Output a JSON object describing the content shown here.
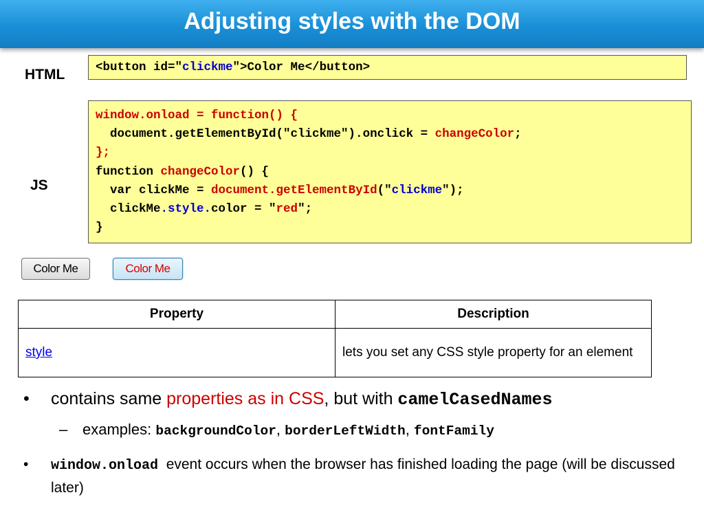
{
  "title": "Adjusting styles with the DOM",
  "labels": {
    "html": "HTML",
    "js": "JS"
  },
  "html_code": {
    "p1": "<button id=\"",
    "p2": "clickme",
    "p3": "\">Color Me</button>"
  },
  "js_code": {
    "l1": "window.onload = function() {",
    "l2a": "  document.getElementById(\"clickme\").onclick = ",
    "l2b": "changeColor",
    "l2c": ";",
    "l3": "};",
    "l4a": "function ",
    "l4b": "changeColor",
    "l4c": "() {",
    "l5a": "  var clickMe = ",
    "l5b": "document.getElementById",
    "l5c": "(\"",
    "l5d": "clickme",
    "l5e": "\");",
    "l6a": "  clickMe",
    "l6b": ".style.",
    "l6c": "color = \"",
    "l6d": "red",
    "l6e": "\";",
    "l7": "}"
  },
  "demo_buttons": [
    {
      "label": "Color Me",
      "text_color": "#000000"
    },
    {
      "label": "Color Me",
      "text_color": "#d40000"
    }
  ],
  "table": {
    "headers": [
      "Property",
      "Description"
    ],
    "rows": [
      {
        "property": "style",
        "description": "lets you set any CSS style property for an element"
      }
    ]
  },
  "bullets": {
    "b1": {
      "marker": "•",
      "t1": "contains same ",
      "t2": "properties as in CSS",
      "t3": ", but with ",
      "t4": "camelCasedNames"
    },
    "b2": {
      "marker": "–",
      "t1": "examples: ",
      "t2": "backgroundColor",
      "t3": ", ",
      "t4": "borderLeftWidth",
      "t5": ", ",
      "t6": "fontFamily"
    },
    "b3": {
      "marker": "•",
      "t1": "window.onload",
      "t2": "  event occurs when the browser has finished loading the page (will be discussed later)"
    }
  },
  "colors": {
    "title_bar": "#1a8fd6",
    "code_bg": "#ffff99",
    "keyword_red": "#cc0000",
    "string_blue": "#0000cc"
  }
}
